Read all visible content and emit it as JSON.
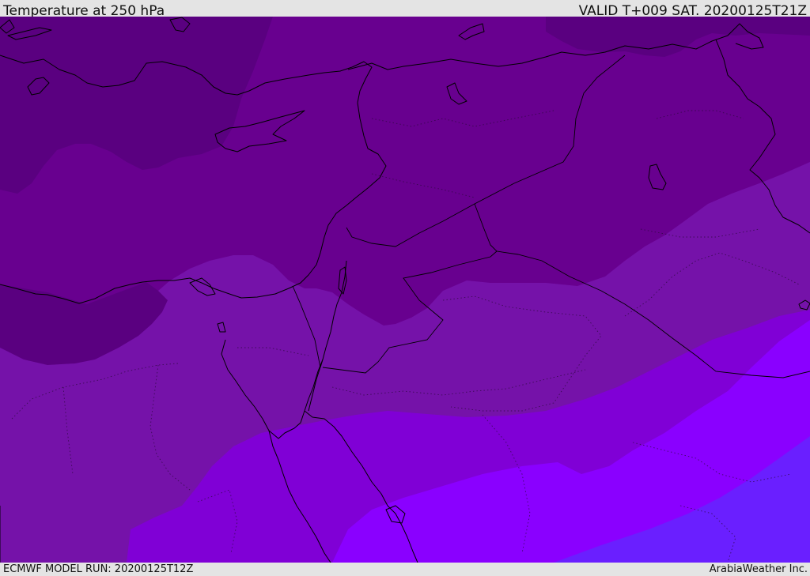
{
  "header": {
    "title": "Temperature at 250 hPa",
    "valid": "VALID T+009 SAT. 20200125T21Z"
  },
  "footer": {
    "model_run": "ECMWF MODEL RUN: 20200125T12Z",
    "credit": "ArabiaWeather Inc."
  },
  "map": {
    "variable": "Temperature",
    "level": "250 hPa",
    "colors": {
      "band_darkest": "#5a0080",
      "band_dark": "#68008f",
      "band_mid": "#7512a9",
      "band_light": "#8000d6",
      "band_lighter": "#8a00ff",
      "band_blue": "#6a1fff",
      "coastline": "#000000"
    }
  }
}
